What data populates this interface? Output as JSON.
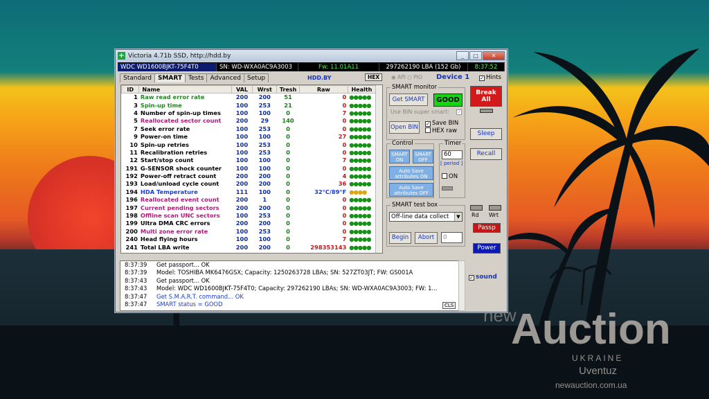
{
  "window": {
    "title": "Victoria 4.71b SSD, http://hdd.by",
    "min": "_",
    "max": "□",
    "close": "✕"
  },
  "infobar": {
    "model": "WDC WD1600BJKT-75F4T0",
    "serial": "SN: WD-WXA0AC9A3003",
    "firmware": "Fw: 11.01A11",
    "lba": "297262190 LBA (152 Gb)",
    "time": "8:37:52"
  },
  "tabs": [
    "Standard",
    "SMART",
    "Tests",
    "Advanced",
    "Setup"
  ],
  "active_tab": "SMART",
  "hddby": "HDD.BY",
  "hex": "HEX",
  "radio_api": "API",
  "radio_pio": "PIO",
  "device": "Device 1",
  "hints": "Hints",
  "table": {
    "headers": [
      "ID",
      "Name",
      "VAL",
      "Wrst",
      "Tresh",
      "Raw",
      "Health"
    ],
    "rows": [
      {
        "id": "1",
        "name": "Raw read error rate",
        "val": "200",
        "wrst": "200",
        "tresh": "51",
        "raw": "0",
        "health": "●●●●●",
        "color": "#1b8a1b"
      },
      {
        "id": "3",
        "name": "Spin-up time",
        "val": "100",
        "wrst": "253",
        "tresh": "21",
        "raw": "0",
        "health": "●●●●●",
        "color": "#1b8a1b"
      },
      {
        "id": "4",
        "name": "Number of spin-up times",
        "val": "100",
        "wrst": "100",
        "tresh": "0",
        "raw": "7",
        "health": "●●●●●",
        "color": "#000000"
      },
      {
        "id": "5",
        "name": "Reallocated sector count",
        "val": "200",
        "wrst": "29",
        "tresh": "140",
        "raw": "0",
        "health": "●●●●●",
        "color": "#b01a7a"
      },
      {
        "id": "7",
        "name": "Seek error rate",
        "val": "100",
        "wrst": "253",
        "tresh": "0",
        "raw": "0",
        "health": "●●●●●",
        "color": "#000000"
      },
      {
        "id": "9",
        "name": "Power-on time",
        "val": "100",
        "wrst": "100",
        "tresh": "0",
        "raw": "27",
        "health": "●●●●●",
        "color": "#000000"
      },
      {
        "id": "10",
        "name": "Spin-up retries",
        "val": "100",
        "wrst": "253",
        "tresh": "0",
        "raw": "0",
        "health": "●●●●●",
        "color": "#000000"
      },
      {
        "id": "11",
        "name": "Recalibration retries",
        "val": "100",
        "wrst": "253",
        "tresh": "0",
        "raw": "0",
        "health": "●●●●●",
        "color": "#000000"
      },
      {
        "id": "12",
        "name": "Start/stop count",
        "val": "100",
        "wrst": "100",
        "tresh": "0",
        "raw": "7",
        "health": "●●●●●",
        "color": "#000000"
      },
      {
        "id": "191",
        "name": "G-SENSOR shock counter",
        "val": "100",
        "wrst": "100",
        "tresh": "0",
        "raw": "0",
        "health": "●●●●●",
        "color": "#000000"
      },
      {
        "id": "192",
        "name": "Power-off retract count",
        "val": "200",
        "wrst": "200",
        "tresh": "0",
        "raw": "4",
        "health": "●●●●●",
        "color": "#000000"
      },
      {
        "id": "193",
        "name": "Load/unload cycle count",
        "val": "200",
        "wrst": "200",
        "tresh": "0",
        "raw": "36",
        "health": "●●●●●",
        "color": "#000000"
      },
      {
        "id": "194",
        "name": "HDA Temperature",
        "val": "111",
        "wrst": "100",
        "tresh": "0",
        "raw": "32°C/89°F",
        "health": "●●●●",
        "color": "#1b3cd0",
        "rawcolor": "#1b3cd0",
        "yellow": true
      },
      {
        "id": "196",
        "name": "Reallocated event count",
        "val": "200",
        "wrst": "1",
        "tresh": "0",
        "raw": "0",
        "health": "●●●●●",
        "color": "#b01a7a"
      },
      {
        "id": "197",
        "name": "Current pending sectors",
        "val": "200",
        "wrst": "200",
        "tresh": "0",
        "raw": "0",
        "health": "●●●●●",
        "color": "#b01a7a"
      },
      {
        "id": "198",
        "name": "Offline scan UNC sectors",
        "val": "100",
        "wrst": "253",
        "tresh": "0",
        "raw": "0",
        "health": "●●●●●",
        "color": "#b01a7a"
      },
      {
        "id": "199",
        "name": "Ultra DMA CRC errors",
        "val": "200",
        "wrst": "200",
        "tresh": "0",
        "raw": "0",
        "health": "●●●●●",
        "color": "#000000"
      },
      {
        "id": "200",
        "name": "Multi zone error rate",
        "val": "100",
        "wrst": "253",
        "tresh": "0",
        "raw": "0",
        "health": "●●●●●",
        "color": "#b01a7a"
      },
      {
        "id": "240",
        "name": "Head flying hours",
        "val": "100",
        "wrst": "100",
        "tresh": "0",
        "raw": "7",
        "health": "●●●●●",
        "color": "#000000"
      },
      {
        "id": "241",
        "name": "Total LBA write",
        "val": "200",
        "wrst": "200",
        "tresh": "0",
        "raw": "298353143",
        "health": "●●●●●",
        "color": "#000000"
      }
    ]
  },
  "smart_monitor": {
    "label": "SMART monitor",
    "get_smart": "Get SMART",
    "status": "GOOD",
    "bin_super": "Use BIN super smart:",
    "open_bin": "Open BIN",
    "save_bin": "Save BIN",
    "hex_raw": "HEX raw"
  },
  "control": {
    "label": "Control",
    "smart_on": "SMART ON",
    "smart_off": "SMART OFF",
    "autosave_on": "Auto Save attributes ON",
    "autosave_off": "Auto Save attributes OFF"
  },
  "timer": {
    "label": "Timer",
    "value": "60",
    "period": "[ period ]",
    "on": "ON"
  },
  "test_box": {
    "label": "SMART test box",
    "selected": "Off-line data collect",
    "begin": "Begin",
    "abort": "Abort",
    "count": "0"
  },
  "right": {
    "break": "Break All",
    "sleep": "Sleep",
    "recall": "Recall",
    "rd": "Rd",
    "wrt": "Wrt",
    "passp": "Passp",
    "power": "Power",
    "sound": "sound"
  },
  "log": [
    {
      "t": "8:37:39",
      "m": "Get passport... OK",
      "blue": false
    },
    {
      "t": "8:37:39",
      "m": "Model: TOSHIBA MK6476GSX; Capacity: 1250263728 LBAs; SN: 527ZT03JT; FW: GS001A",
      "blue": false
    },
    {
      "t": "8:37:43",
      "m": "Get passport... OK",
      "blue": false
    },
    {
      "t": "8:37:43",
      "m": "Model: WDC WD1600BJKT-75F4T0; Capacity: 297262190 LBAs; SN: WD-WXA0AC9A3003; FW: 1...",
      "blue": false
    },
    {
      "t": "8:37:47",
      "m": "Get S.M.A.R.T. command... OK",
      "blue": true
    },
    {
      "t": "8:37:47",
      "m": "SMART status = GOOD",
      "blue": true
    }
  ],
  "cls": "CLS",
  "watermark": {
    "new": "new",
    "auction": "Auction",
    "ukraine": "UKRAINE",
    "user": "Uventuz",
    "site": "newauction.com.ua"
  }
}
